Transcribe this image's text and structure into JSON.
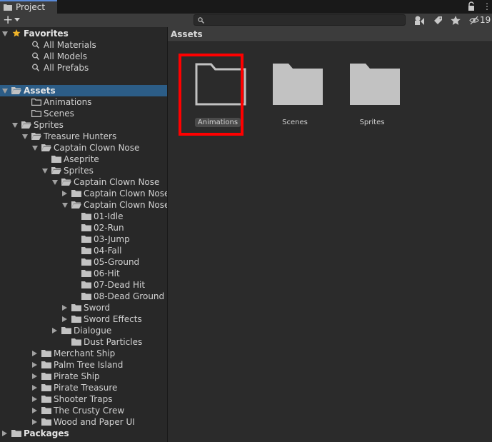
{
  "window": {
    "tab_label": "Project"
  },
  "toolbar": {
    "search_placeholder": "",
    "hidden_count": "19"
  },
  "tree": {
    "items": [
      {
        "label": "Favorites",
        "depth": 0,
        "arrow": "down",
        "icon": "star",
        "bold": true
      },
      {
        "label": "All Materials",
        "depth": 2,
        "arrow": "",
        "icon": "search"
      },
      {
        "label": "All Models",
        "depth": 2,
        "arrow": "",
        "icon": "search"
      },
      {
        "label": "All Prefabs",
        "depth": 2,
        "arrow": "",
        "icon": "search"
      },
      {
        "label": "",
        "depth": 0,
        "arrow": "",
        "icon": "none"
      },
      {
        "label": "Assets",
        "depth": 0,
        "arrow": "down",
        "icon": "folder-open",
        "bold": true,
        "selected": true
      },
      {
        "label": "Animations",
        "depth": 2,
        "arrow": "",
        "icon": "folder-empty"
      },
      {
        "label": "Scenes",
        "depth": 2,
        "arrow": "",
        "icon": "folder-empty"
      },
      {
        "label": "Sprites",
        "depth": 1,
        "arrow": "down",
        "icon": "folder-open"
      },
      {
        "label": "Treasure Hunters",
        "depth": 2,
        "arrow": "down",
        "icon": "folder-open"
      },
      {
        "label": "Captain Clown Nose",
        "depth": 3,
        "arrow": "down",
        "icon": "folder-open"
      },
      {
        "label": "Aseprite",
        "depth": 4,
        "arrow": "",
        "icon": "folder"
      },
      {
        "label": "Sprites",
        "depth": 4,
        "arrow": "down",
        "icon": "folder-open"
      },
      {
        "label": "Captain Clown Nose",
        "depth": 5,
        "arrow": "down",
        "icon": "folder-open"
      },
      {
        "label": "Captain Clown Nose",
        "depth": 6,
        "arrow": "right",
        "icon": "folder"
      },
      {
        "label": "Captain Clown Nose",
        "depth": 6,
        "arrow": "down",
        "icon": "folder-open"
      },
      {
        "label": "01-Idle",
        "depth": 7,
        "arrow": "",
        "icon": "folder"
      },
      {
        "label": "02-Run",
        "depth": 7,
        "arrow": "",
        "icon": "folder"
      },
      {
        "label": "03-Jump",
        "depth": 7,
        "arrow": "",
        "icon": "folder"
      },
      {
        "label": "04-Fall",
        "depth": 7,
        "arrow": "",
        "icon": "folder"
      },
      {
        "label": "05-Ground",
        "depth": 7,
        "arrow": "",
        "icon": "folder"
      },
      {
        "label": "06-Hit",
        "depth": 7,
        "arrow": "",
        "icon": "folder"
      },
      {
        "label": "07-Dead Hit",
        "depth": 7,
        "arrow": "",
        "icon": "folder"
      },
      {
        "label": "08-Dead Ground",
        "depth": 7,
        "arrow": "",
        "icon": "folder"
      },
      {
        "label": "Sword",
        "depth": 6,
        "arrow": "right",
        "icon": "folder"
      },
      {
        "label": "Sword Effects",
        "depth": 6,
        "arrow": "right",
        "icon": "folder"
      },
      {
        "label": "Dialogue",
        "depth": 5,
        "arrow": "right",
        "icon": "folder"
      },
      {
        "label": "Dust Particles",
        "depth": 6,
        "arrow": "",
        "icon": "folder"
      },
      {
        "label": "Merchant Ship",
        "depth": 3,
        "arrow": "right",
        "icon": "folder"
      },
      {
        "label": "Palm Tree Island",
        "depth": 3,
        "arrow": "right",
        "icon": "folder"
      },
      {
        "label": "Pirate Ship",
        "depth": 3,
        "arrow": "right",
        "icon": "folder"
      },
      {
        "label": "Pirate Treasure",
        "depth": 3,
        "arrow": "right",
        "icon": "folder"
      },
      {
        "label": "Shooter Traps",
        "depth": 3,
        "arrow": "right",
        "icon": "folder"
      },
      {
        "label": "The Crusty Crew",
        "depth": 3,
        "arrow": "right",
        "icon": "folder"
      },
      {
        "label": "Wood and Paper UI",
        "depth": 3,
        "arrow": "right",
        "icon": "folder"
      },
      {
        "label": "Packages",
        "depth": 0,
        "arrow": "right",
        "icon": "folder",
        "bold": true
      }
    ]
  },
  "grid": {
    "header": "Assets",
    "items": [
      {
        "label": "Animations",
        "selected": true
      },
      {
        "label": "Scenes",
        "selected": false
      },
      {
        "label": "Sprites",
        "selected": false
      }
    ]
  },
  "colors": {
    "selection": "#2c5d87",
    "highlight": "#ff0000",
    "folder": "#c2c2c2",
    "star": "#f0b429"
  }
}
